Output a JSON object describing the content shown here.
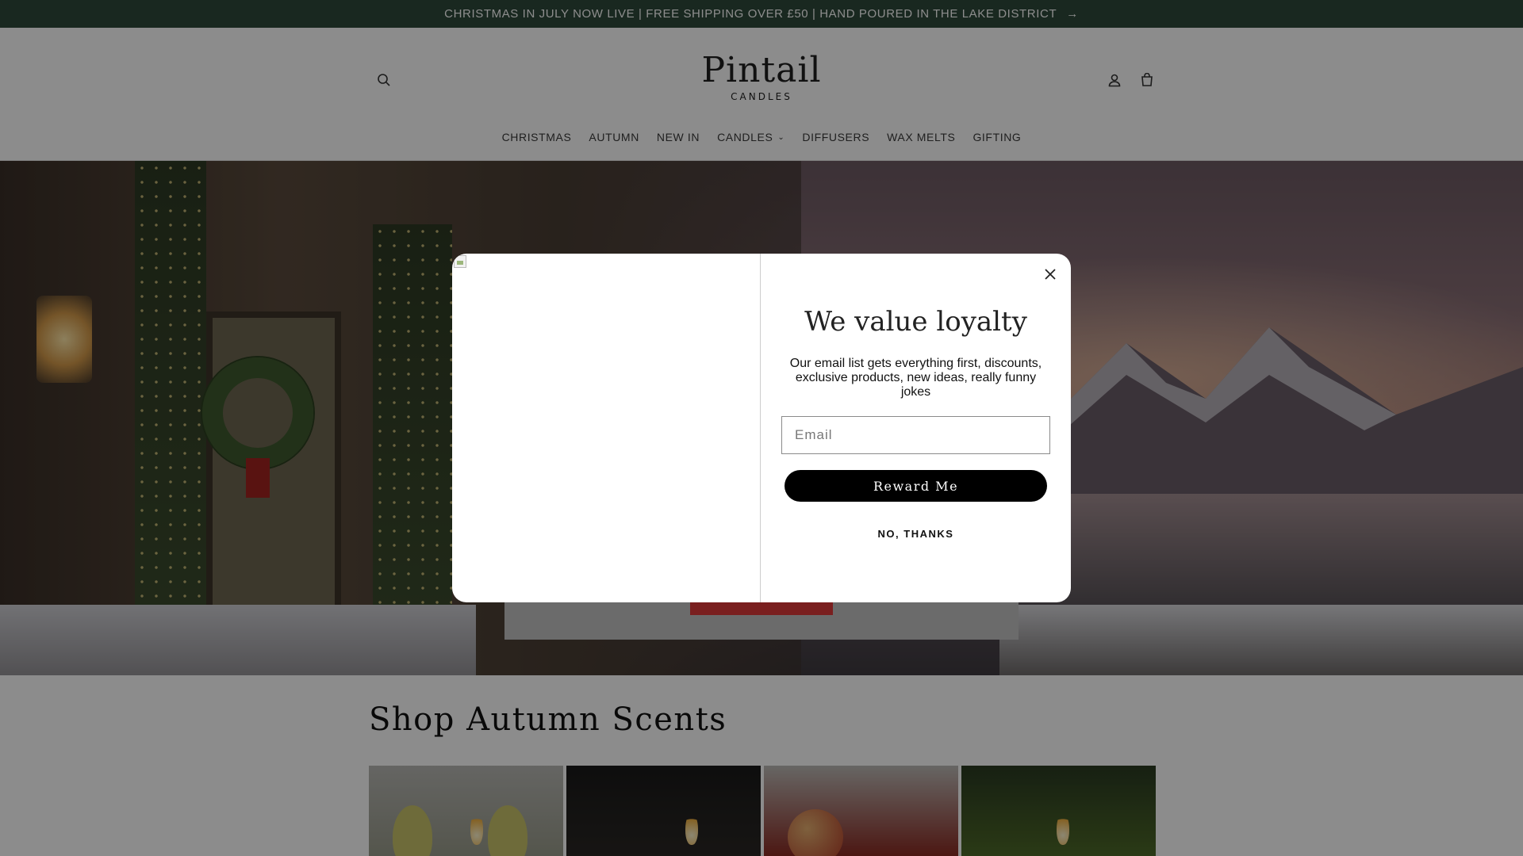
{
  "announcement": {
    "text": "CHRISTMAS IN JULY NOW LIVE | FREE SHIPPING OVER £50 | HAND POURED IN THE LAKE DISTRICT",
    "arrow_icon": "arrow-right-icon"
  },
  "header": {
    "logo_main": "Pintail",
    "logo_sub": "CANDLES",
    "icons": [
      "search-icon",
      "account-icon",
      "cart-icon"
    ]
  },
  "nav": {
    "items": [
      {
        "label": "CHRISTMAS"
      },
      {
        "label": "AUTUMN"
      },
      {
        "label": "NEW IN"
      },
      {
        "label": "CANDLES",
        "has_dropdown": true
      },
      {
        "label": "DIFFUSERS"
      },
      {
        "label": "WAX MELTS"
      },
      {
        "label": "GIFTING"
      }
    ]
  },
  "section": {
    "title": "Shop Autumn Scents"
  },
  "popup": {
    "title": "We value loyalty",
    "text": "Our email list gets everything first, discounts, exclusive products, new ideas, really funny jokes",
    "email_placeholder": "Email",
    "email_value": "",
    "submit_label": "Reward Me",
    "dismiss_label": "NO, THANKS",
    "close_icon": "close-icon"
  },
  "colors": {
    "announcement_bg": "#2f4a3b",
    "button_bg": "#000000",
    "hero_button": "#7a1f1f"
  }
}
